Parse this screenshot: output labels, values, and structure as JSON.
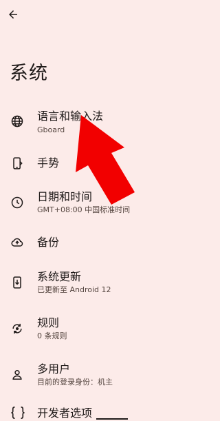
{
  "header": {
    "back_icon": "back-arrow-icon",
    "title": "系统"
  },
  "settings": {
    "language": {
      "title": "语言和输入法",
      "subtitle": "Gboard",
      "icon": "globe-icon"
    },
    "gestures": {
      "title": "手势",
      "icon": "phone-gesture-icon"
    },
    "datetime": {
      "title": "日期和时间",
      "subtitle": "GMT+08:00 中国标准时间",
      "icon": "clock-icon"
    },
    "backup": {
      "title": "备份",
      "icon": "cloud-upload-icon"
    },
    "update": {
      "title": "系统更新",
      "subtitle": "已更新至 Android 12",
      "icon": "system-update-icon"
    },
    "rules": {
      "title": "规则",
      "subtitle": "0 条规则",
      "icon": "rules-icon"
    },
    "users": {
      "title": "多用户",
      "subtitle": "目前的登录身份：机主",
      "icon": "person-icon"
    },
    "developer": {
      "title": "开发者选项",
      "icon": "code-braces-icon"
    }
  },
  "overlay": {
    "annotation_arrow_color": "#f20000"
  },
  "colors": {
    "background": "#fcebe9",
    "text": "#1f1a19",
    "subtext": "#54453f"
  }
}
